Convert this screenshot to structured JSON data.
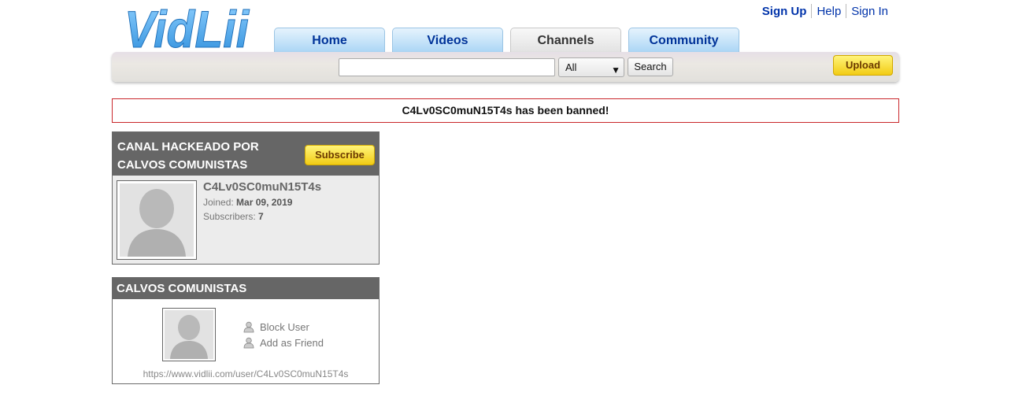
{
  "brand": {
    "logo_text": "VidLii",
    "logo_color": "#4aa8e8"
  },
  "top_links": {
    "sign_up": "Sign Up",
    "help": "Help",
    "sign_in": "Sign In"
  },
  "nav": {
    "tabs": [
      {
        "label": "Home",
        "active": false
      },
      {
        "label": "Videos",
        "active": false
      },
      {
        "label": "Channels",
        "active": true
      },
      {
        "label": "Community",
        "active": false
      }
    ]
  },
  "search": {
    "query": "",
    "category_selected": "All",
    "button_label": "Search",
    "upload_label": "Upload"
  },
  "banner": {
    "text": "C4Lv0SC0muN15T4s has been banned!",
    "border_color": "#c9262a"
  },
  "channel": {
    "title": "CANAL HACKEADO POR CALVOS COMUNISTAS",
    "subscribe_label": "Subscribe",
    "username": "C4Lv0SC0muN15T4s",
    "joined_label": "Joined:",
    "joined_value": "Mar 09, 2019",
    "subscribers_label": "Subscribers:",
    "subscribers_value": "7"
  },
  "profile": {
    "header": "CALVOS COMUNISTAS",
    "block_user": "Block User",
    "add_friend": "Add as Friend",
    "url": "https://www.vidlii.com/user/C4Lv0SC0muN15T4s"
  }
}
